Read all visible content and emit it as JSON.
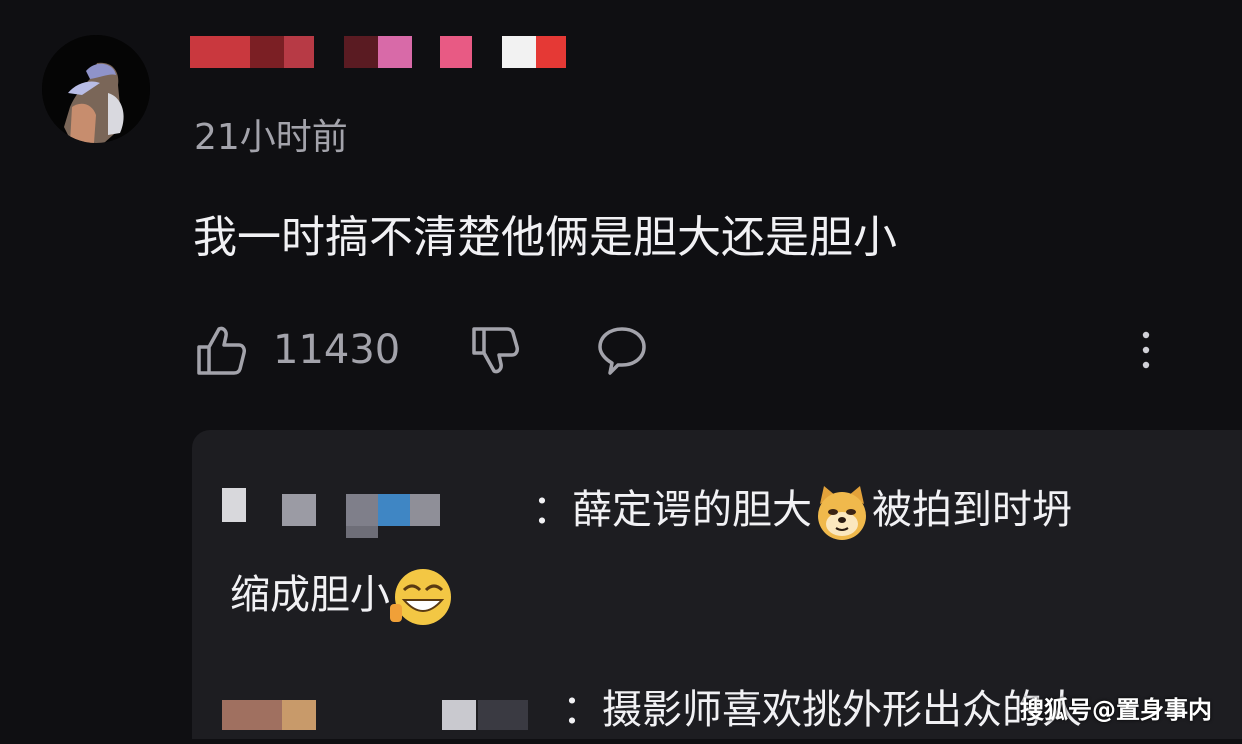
{
  "comment": {
    "username": "",
    "timestamp": "21小时前",
    "text": "我一时搞不清楚他俩是胆大还是胆小",
    "like_count": "11430",
    "icons": [
      "thumbs-up-icon",
      "thumbs-down-icon",
      "reply-bubble-icon",
      "more-options-icon"
    ]
  },
  "replies": [
    {
      "text_before_emoji": "：薛定谔的胆大",
      "emoji_1": "doge-emoji",
      "text_middle": "被拍到时坍",
      "text_line2": "缩成胆小",
      "emoji_2": "laugh-emoji"
    },
    {
      "text": "：摄影师喜欢挑外形出众的人"
    }
  ],
  "watermark": "搜狐号@置身事内",
  "colors": {
    "background": "#0f0f12",
    "reply_box": "#1d1d21",
    "secondary_text": "#a3a3ab",
    "primary_text": "#f1f1f4"
  }
}
